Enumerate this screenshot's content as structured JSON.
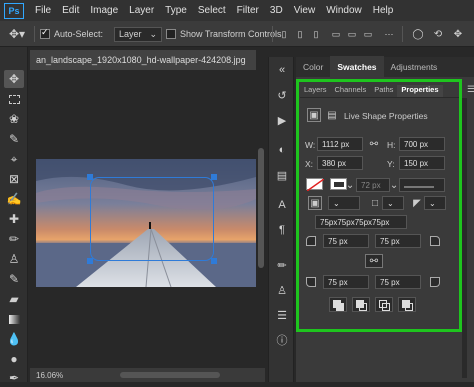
{
  "menubar": {
    "logo": "Ps",
    "items": [
      "File",
      "Edit",
      "Image",
      "Layer",
      "Type",
      "Select",
      "Filter",
      "3D",
      "View",
      "Window",
      "Help"
    ]
  },
  "options": {
    "auto_select_label": "Auto-Select:",
    "auto_select_checked": true,
    "layer_dropdown": "Layer",
    "show_transform_label": "Show Transform Controls",
    "show_transform_checked": false
  },
  "document": {
    "tab_title": "an_landscape_1920x1080_hd-wallpaper-424208.jpg",
    "zoom": "16.06%"
  },
  "panel_groups": {
    "top_tabs": [
      "Color",
      "Swatches",
      "Adjustments"
    ],
    "top_active": "Swatches",
    "props_tabs": [
      "Layers",
      "Channels",
      "Paths",
      "Properties"
    ],
    "props_active": "Properties"
  },
  "properties": {
    "section_title": "Live Shape Properties",
    "w_label": "W:",
    "w_value": "1112 px",
    "h_label": "H:",
    "h_value": "700 px",
    "x_label": "X:",
    "x_value": "380 px",
    "y_label": "Y:",
    "y_value": "150 px",
    "stroke_width": "72 px",
    "corner_combined": "75px75px75px75px",
    "corner_tl": "75 px",
    "corner_tr": "75 px",
    "corner_bl": "75 px",
    "corner_br": "75 px"
  },
  "colors": {
    "accent": "#31a8ff",
    "highlight": "#1ec51e",
    "selection": "#2f7bd8"
  }
}
